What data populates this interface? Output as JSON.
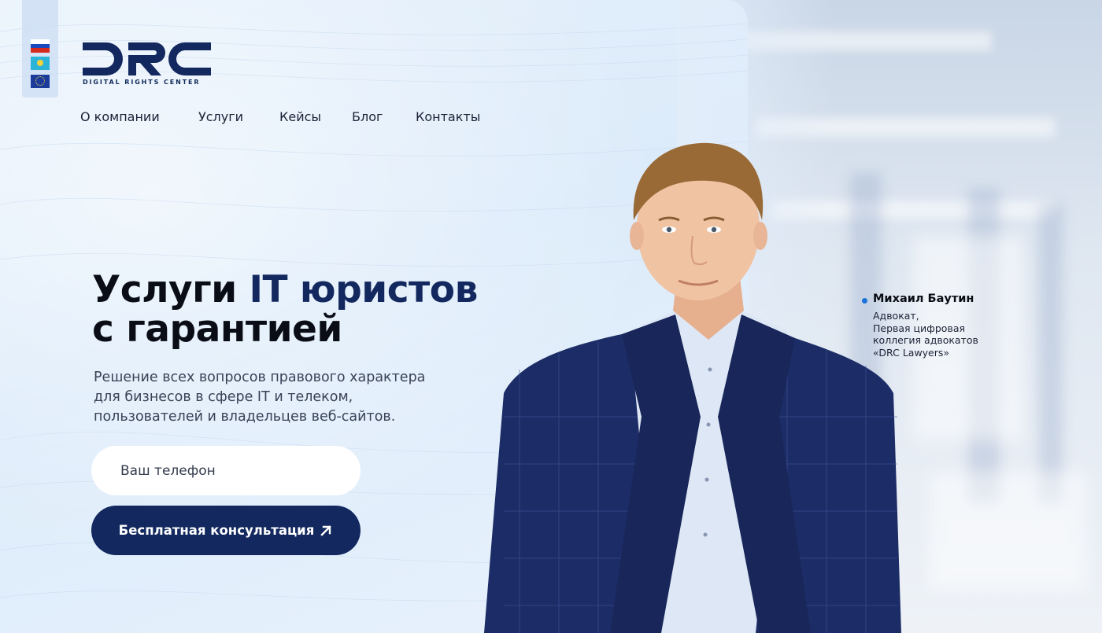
{
  "languages": [
    {
      "code": "ru",
      "icon": "russia-flag-icon"
    },
    {
      "code": "kz",
      "icon": "kazakhstan-flag-icon"
    },
    {
      "code": "eu",
      "icon": "eu-flag-icon"
    }
  ],
  "logo": {
    "text": "DRC",
    "tagline": "DIGITAL RIGHTS CENTER"
  },
  "nav": {
    "items": [
      {
        "label": "О компании"
      },
      {
        "label": "Услуги"
      },
      {
        "label": "Кейсы"
      },
      {
        "label": "Блог"
      },
      {
        "label": "Контакты"
      }
    ]
  },
  "hero": {
    "title_part1": "Услуги ",
    "title_accent": "IT юристов",
    "title_line2": "с гарантией",
    "subtitle_lines": [
      "Решение всех вопросов правового характера",
      "для бизнесов в сфере IT и телеком,",
      "пользователей и владельцев веб-сайтов."
    ],
    "phone_placeholder": "Ваш телефон",
    "cta_label": "Бесплатная консультация",
    "cta_icon": "arrow-up-right-icon"
  },
  "person": {
    "name": "Михаил Баутин",
    "role_lines": [
      "Адвокат,",
      "Первая цифровая",
      "коллегия адвокатов",
      " «DRC Lawyers»"
    ]
  },
  "colors": {
    "brand_navy": "#12285e",
    "accent_blue": "#1a73d9",
    "panel_bg": "#e3eefa",
    "text_dark": "#0b0d16"
  }
}
